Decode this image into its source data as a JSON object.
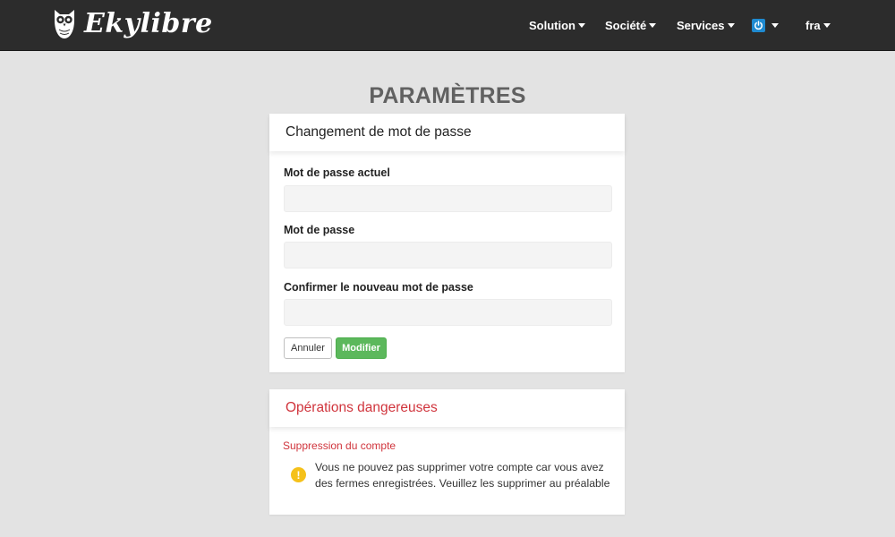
{
  "navbar": {
    "brand": "Ekylibre",
    "items": [
      {
        "label": "Solution"
      },
      {
        "label": "Société"
      },
      {
        "label": "Services"
      }
    ],
    "power_icon": "power-icon",
    "language": "fra"
  },
  "page": {
    "title": "PARAMÈTRES"
  },
  "password_card": {
    "title": "Changement de mot de passe",
    "current_label": "Mot de passe actuel",
    "current_value": "",
    "new_label": "Mot de passe",
    "new_value": "",
    "confirm_label": "Confirmer le nouveau mot de passe",
    "confirm_value": "",
    "cancel_label": "Annuler",
    "submit_label": "Modifier"
  },
  "danger_card": {
    "title": "Opérations dangereuses",
    "subtitle": "Suppression du compte",
    "warning_icon": "exclamation-icon",
    "warning_text": "Vous ne pouvez pas supprimer votre compte car vous avez des fermes enregistrées. Veuillez les supprimer au préalable"
  },
  "colors": {
    "navbar_bg": "#2c2c2c",
    "page_bg": "#e3e3e3",
    "danger": "#d0343c",
    "success": "#5cb85c",
    "warning": "#f5c11a",
    "power_accent": "#1f8ad0"
  }
}
